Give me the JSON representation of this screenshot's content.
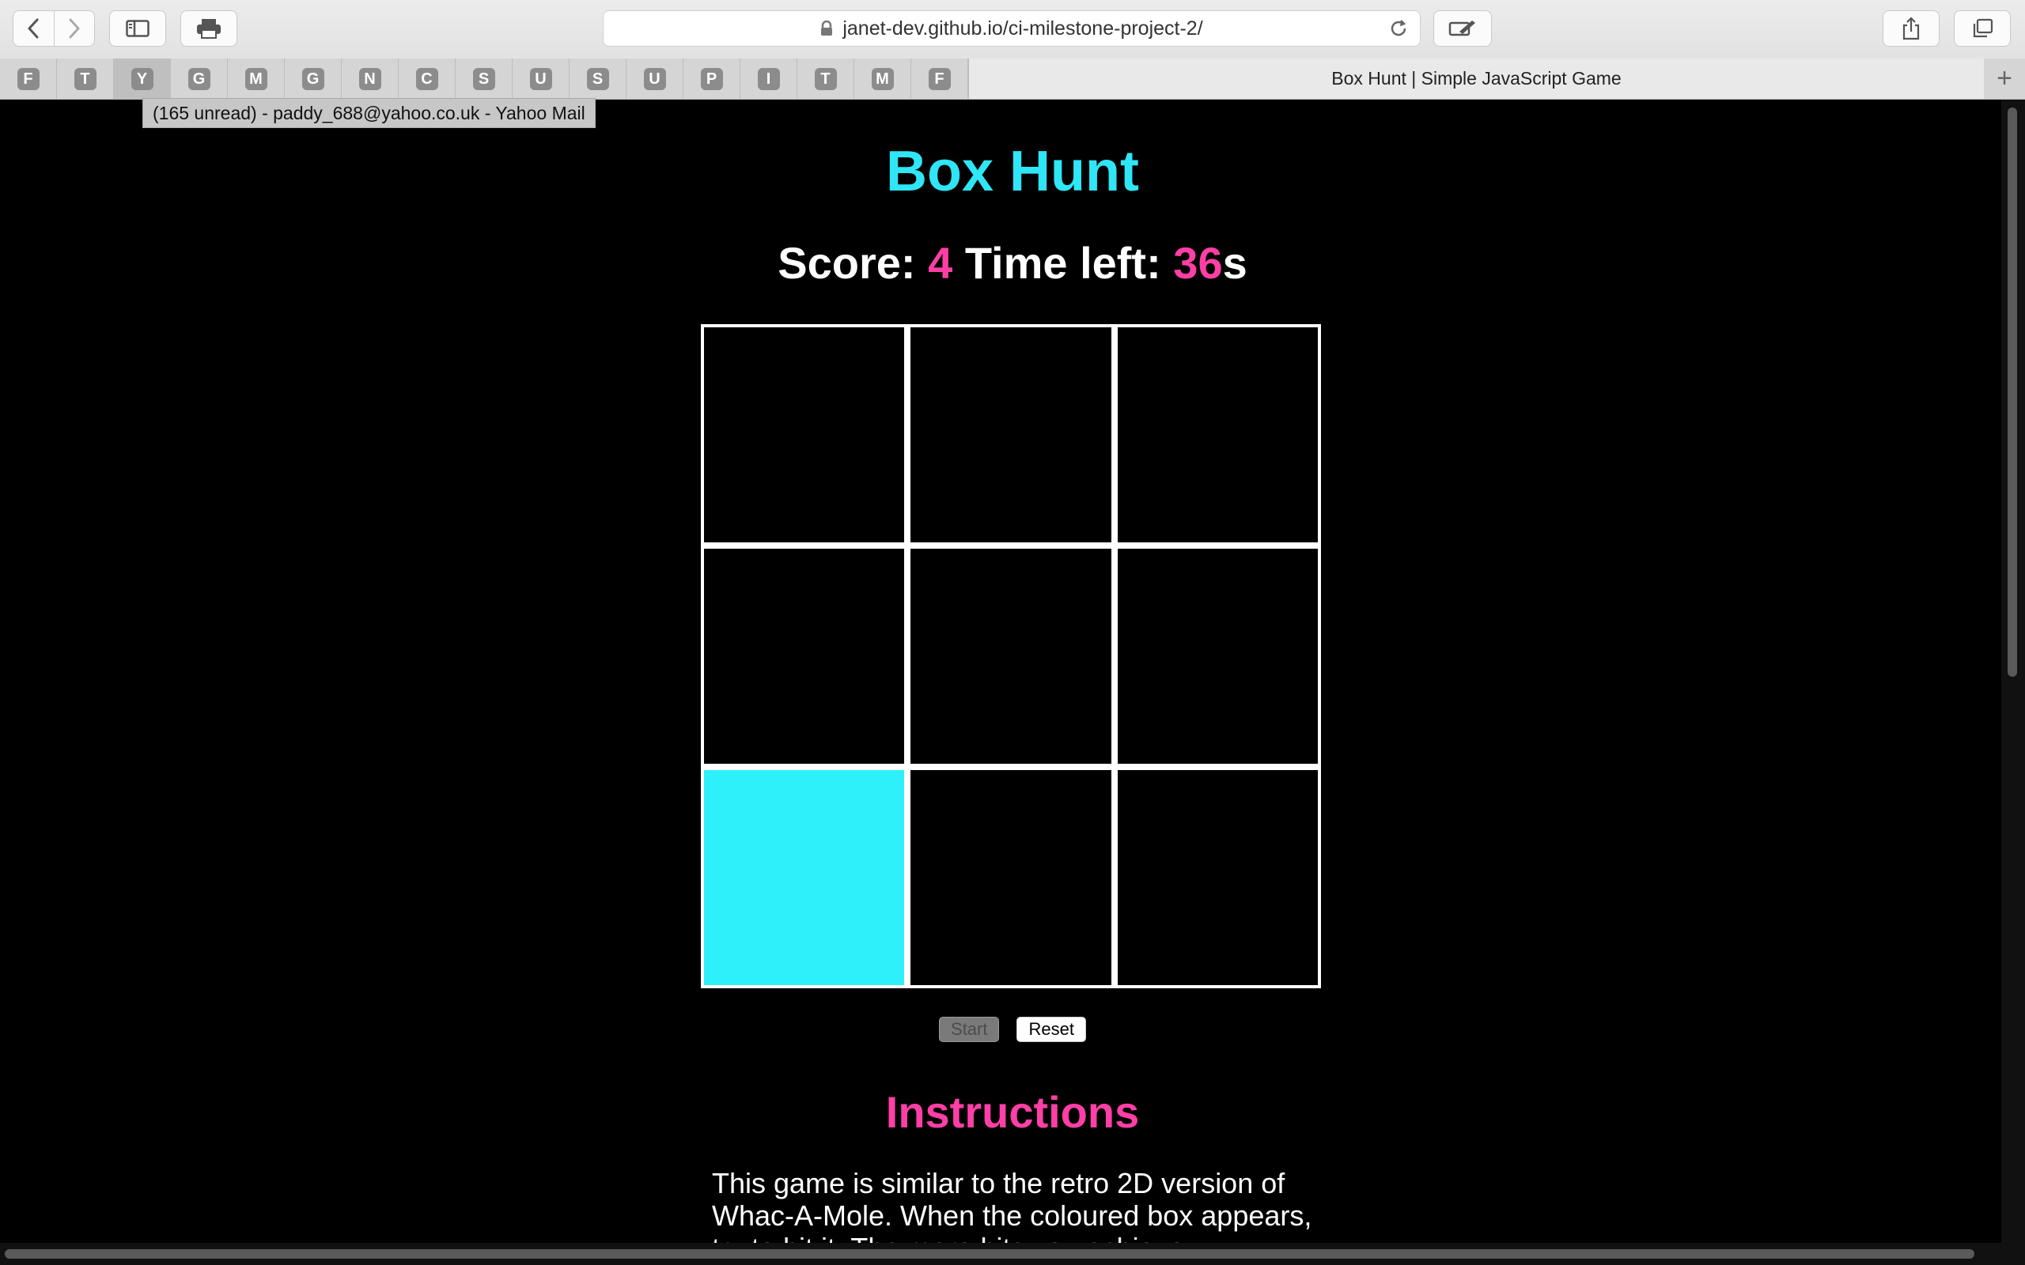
{
  "browser": {
    "url": "janet-dev.github.io/ci-milestone-project-2/",
    "active_tab_title": "Box Hunt | Simple JavaScript Game",
    "pinned_tabs": [
      "F",
      "T",
      "Y",
      "G",
      "M",
      "G",
      "N",
      "C",
      "S",
      "U",
      "S",
      "U",
      "P",
      "I",
      "T",
      "M",
      "F"
    ],
    "tooltip": "(165 unread) - paddy_688@yahoo.co.uk - Yahoo Mail",
    "new_tab_label": "+"
  },
  "game": {
    "title": "Box Hunt",
    "score_label": "Score:",
    "score": "4",
    "time_label": "Time left:",
    "time_left": "36",
    "time_unit": "s",
    "grid": {
      "rows": 3,
      "cols": 3,
      "lit_cell": "row 3, column 1",
      "lit_color": "#2ef0fb"
    },
    "start_label": "Start",
    "reset_label": "Reset",
    "instructions_heading": "Instructions",
    "instructions_text": "This game is similar to the retro 2D version of Whac-A-Mole. When the coloured box appears, try to hit it. The more hits you achieve"
  },
  "colors": {
    "title": "#2ee6f6",
    "accent": "#ff3fa6",
    "background": "#000000"
  }
}
